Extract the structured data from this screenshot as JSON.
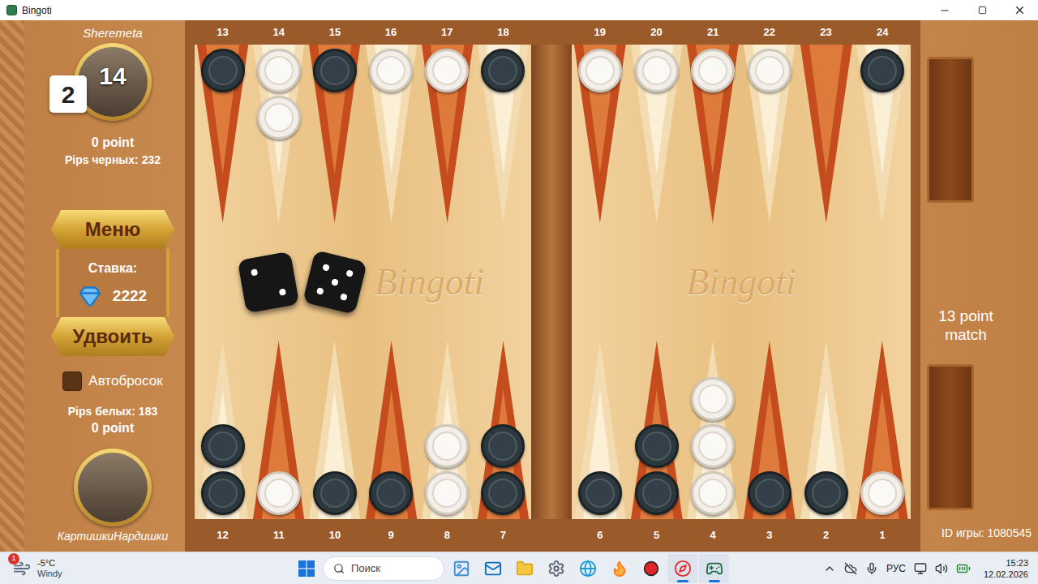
{
  "window": {
    "title": "Bingoti"
  },
  "top_player": {
    "name": "Sheremeta",
    "score": "14",
    "cube": "2",
    "points": "0 point",
    "pips": "Pips черных: 232"
  },
  "bottom_player": {
    "name": "КартишкиНардишки",
    "points": "0 point",
    "pips": "Pips белых: 183"
  },
  "controls": {
    "menu": "Меню",
    "stake_label": "Ставка:",
    "stake": "2222",
    "double": "Удвоить",
    "auto_roll": {
      "label": "Автобросок",
      "checked": false
    }
  },
  "board": {
    "top_points": [
      {
        "number": "13",
        "count": 1,
        "checker": "black"
      },
      {
        "number": "14",
        "count": 2,
        "checker": "white"
      },
      {
        "number": "15",
        "count": 1,
        "checker": "black"
      },
      {
        "number": "16",
        "count": 1,
        "checker": "white"
      },
      {
        "number": "17",
        "count": 1,
        "checker": "white"
      },
      {
        "number": "18",
        "count": 1,
        "checker": "black"
      },
      {
        "number": "19",
        "count": 1,
        "checker": "white"
      },
      {
        "number": "20",
        "count": 1,
        "checker": "white"
      },
      {
        "number": "21",
        "count": 1,
        "checker": "white"
      },
      {
        "number": "22",
        "count": 1,
        "checker": "white"
      },
      {
        "number": "23",
        "count": 0,
        "checker": "none"
      },
      {
        "number": "24",
        "count": 1,
        "checker": "black"
      }
    ],
    "bottom_points": [
      {
        "number": "12",
        "count": 2,
        "checker": "black"
      },
      {
        "number": "11",
        "count": 1,
        "checker": "white"
      },
      {
        "number": "10",
        "count": 1,
        "checker": "black"
      },
      {
        "number": "9",
        "count": 1,
        "checker": "black"
      },
      {
        "number": "8",
        "count": 2,
        "checker": "white"
      },
      {
        "number": "7",
        "count": 2,
        "checker": "black"
      },
      {
        "number": "6",
        "count": 1,
        "checker": "black"
      },
      {
        "number": "5",
        "count": 2,
        "checker": "black"
      },
      {
        "number": "4",
        "count": 3,
        "checker": "white"
      },
      {
        "number": "3",
        "count": 1,
        "checker": "black"
      },
      {
        "number": "2",
        "count": 1,
        "checker": "black"
      },
      {
        "number": "1",
        "count": 1,
        "checker": "white"
      }
    ],
    "watermarks": [
      "Bingoti",
      "Bingoti"
    ],
    "dice": [
      {
        "pips": 2
      },
      {
        "pips": 5
      }
    ]
  },
  "match": {
    "title": "13 point match",
    "game_id": "ID игры: 1080545"
  },
  "taskbar": {
    "weather": {
      "temperature": "-5°C",
      "condition": "Windy",
      "badge": "1"
    },
    "search": {
      "placeholder": "Поиск"
    },
    "apps": [
      {
        "kind": "photos",
        "active": false
      },
      {
        "kind": "outlook",
        "active": false
      },
      {
        "kind": "explorer",
        "active": false
      },
      {
        "kind": "settings",
        "active": false
      },
      {
        "kind": "edge",
        "active": false
      },
      {
        "kind": "firefox",
        "active": false
      },
      {
        "kind": "recorder",
        "active": false
      },
      {
        "kind": "browser",
        "active": true
      },
      {
        "kind": "bingoti",
        "active": true
      }
    ],
    "language": "РУС",
    "time": "15:23",
    "date": "12.02.2026"
  }
}
